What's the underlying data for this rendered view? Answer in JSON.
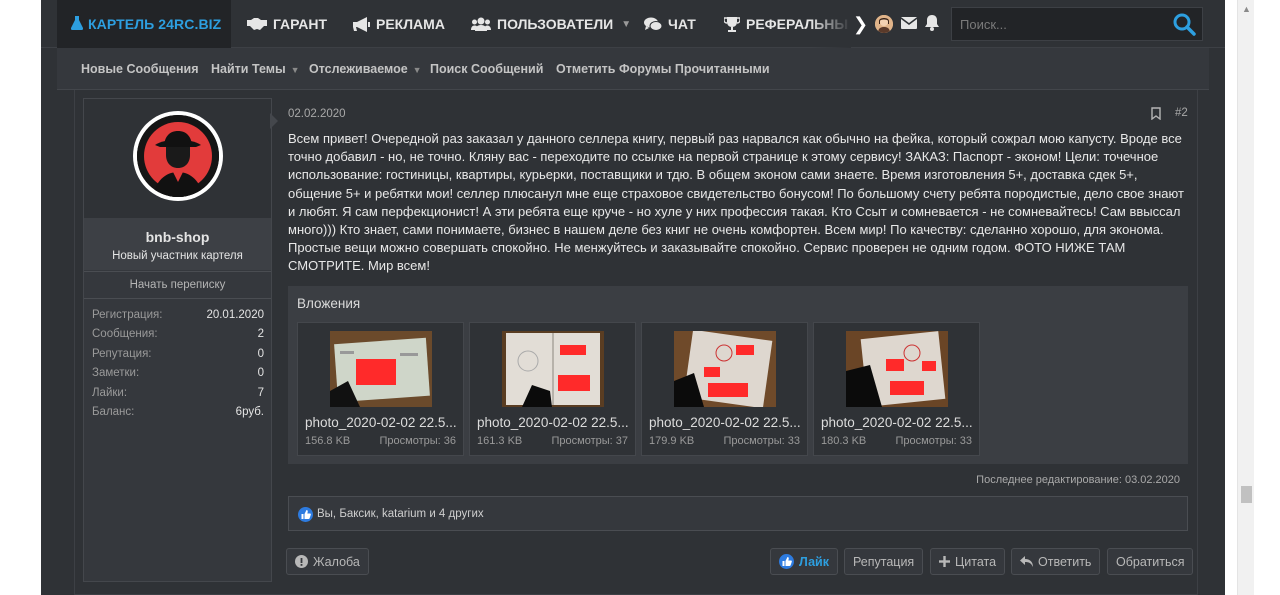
{
  "colors": {
    "accent": "#2d9fe0",
    "background": "#2f3236",
    "panel": "#35383d",
    "text": "#e8e8e8"
  },
  "site": {
    "logo_text": "КАРТЕЛЬ 24RC.BIZ"
  },
  "nav": {
    "items": [
      {
        "label": "ГАРАНТ",
        "icon": "handshake-icon"
      },
      {
        "label": "РЕКЛАМА",
        "icon": "megaphone-icon"
      },
      {
        "label": "ПОЛЬЗОВАТЕЛИ",
        "icon": "users-icon"
      },
      {
        "label": "ЧАТ",
        "icon": "chat-icon"
      },
      {
        "label": "РЕФЕРАЛЬНЫ",
        "icon": "trophy-icon"
      }
    ]
  },
  "search": {
    "placeholder": "Поиск..."
  },
  "subnav": {
    "items": [
      "Новые Сообщения",
      "Найти Темы",
      "Отслеживаемое",
      "Поиск Сообщений",
      "Отметить Форумы Прочитанными"
    ]
  },
  "user": {
    "name": "bnb-shop",
    "title": "Новый участник картеля",
    "start_convo": "Начать переписку",
    "stats": [
      {
        "k": "Регистрация:",
        "v": "20.01.2020"
      },
      {
        "k": "Сообщения:",
        "v": "2"
      },
      {
        "k": "Репутация:",
        "v": "0"
      },
      {
        "k": "Заметки:",
        "v": "0"
      },
      {
        "k": "Лайки:",
        "v": "7"
      },
      {
        "k": "Баланс:",
        "v": "6руб."
      }
    ]
  },
  "post": {
    "date": "02.02.2020",
    "number": "#2",
    "body": "Всем привет! Очередной раз заказал у данного селлера книгу, первый раз нарвался как обычно на фейка, который сожрал мою капусту. Вроде все точно добавил - но, не точно. Кляну вас - переходите по ссылке на первой странице к этому сервису! ЗАКАЗ: Паспорт - эконом! Цели: точечное использование: гостиницы, квартиры, курьерки, поставщики и тдю. В общем эконом сами знаете. Время изготовления 5+, доставка сдек 5+, общение 5+ и ребятки мои! селлер плюсанул мне еще страховое свидетельство бонусом! По большому счету ребята породистые, дело свое знают и любят. Я сам перфекционист! А эти ребята еще круче - но хуле у них профессия такая. Кто Ссыт и сомневается - не сомневайтесь! Сам ввыссал много))) Кто знает, сами понимаете, бизнес в нашем деле без книг не очень комфортен. Всем мир! По качеству: сделанно хорошо, для эконома. Простые вещи можно совершать спокойно. Не менжуйтесь и заказывайте спокойно. Сервис проверен не одним годом. ФОТО НИЖЕ ТАМ СМОТРИТЕ. Мир всем!",
    "attachments_title": "Вложения",
    "attachments": [
      {
        "name": "photo_2020-02-02 22.5...",
        "size": "156.8 KB",
        "views": "Просмотры: 36"
      },
      {
        "name": "photo_2020-02-02 22.5...",
        "size": "161.3 KB",
        "views": "Просмотры: 37"
      },
      {
        "name": "photo_2020-02-02 22.5...",
        "size": "179.9 KB",
        "views": "Просмотры: 33"
      },
      {
        "name": "photo_2020-02-02 22.5...",
        "size": "180.3 KB",
        "views": "Просмотры: 33"
      }
    ],
    "last_edit": "Последнее редактирование: 03.02.2020",
    "reactions": "Вы, Баксик, katarium и 4 других",
    "actions": {
      "report": "Жалоба",
      "like": "Лайк",
      "reputation": "Репутация",
      "quote": "Цитата",
      "reply": "Ответить",
      "contact": "Обратиться"
    }
  }
}
